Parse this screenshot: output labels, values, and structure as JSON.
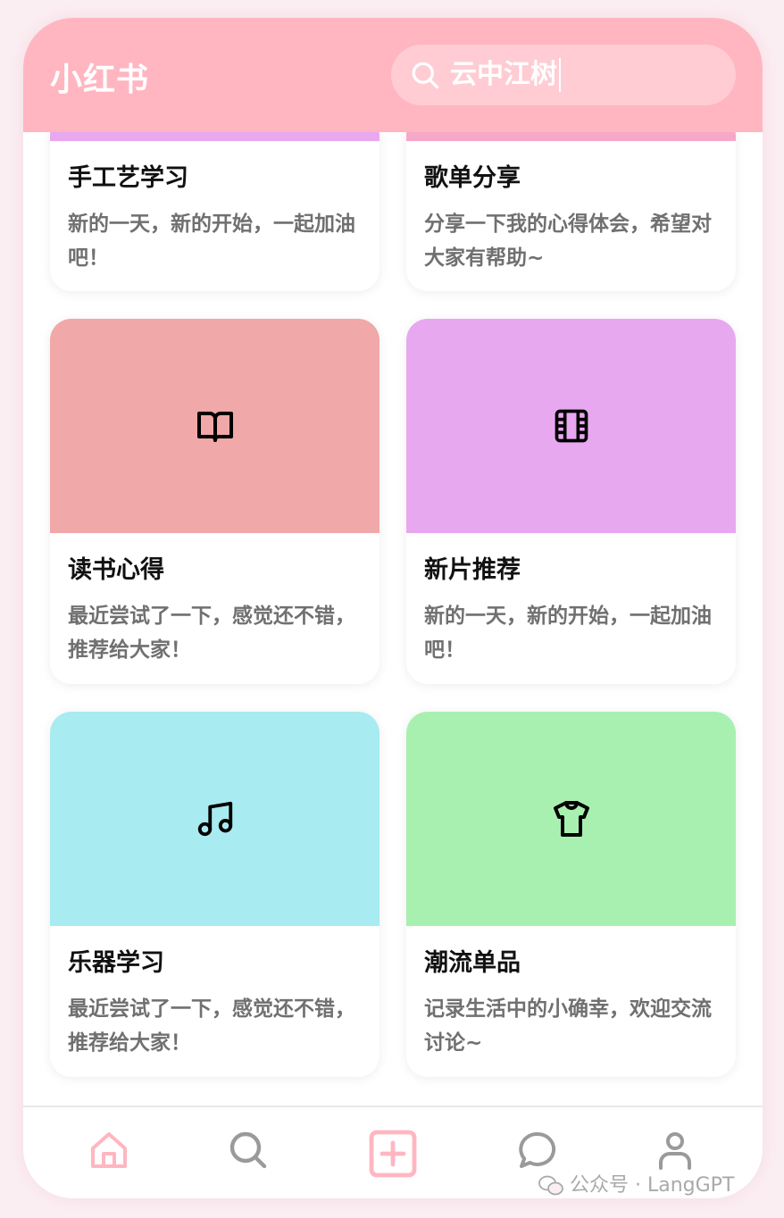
{
  "app": {
    "brand": "小红书"
  },
  "search": {
    "query": "云中江树"
  },
  "colors": {
    "header": "#ffb6c1",
    "card_top_left": "#e8a8f0",
    "card_top_right": "#f5a8c8",
    "reading": "#f0a8a8",
    "movie": "#e8a8f0",
    "music": "#a8ebf0",
    "fashion": "#a8f0b0"
  },
  "feed": {
    "cards": [
      {
        "title": "手工艺学习",
        "desc": "新的一天，新的开始，一起加油吧！",
        "icon": ""
      },
      {
        "title": "歌单分享",
        "desc": "分享一下我的心得体会，希望对大家有帮助~",
        "icon": ""
      },
      {
        "title": "读书心得",
        "desc": "最近尝试了一下，感觉还不错，推荐给大家！",
        "icon": "book-icon"
      },
      {
        "title": "新片推荐",
        "desc": "新的一天，新的开始，一起加油吧！",
        "icon": "film-icon"
      },
      {
        "title": "乐器学习",
        "desc": "最近尝试了一下，感觉还不错，推荐给大家！",
        "icon": "music-note-icon"
      },
      {
        "title": "潮流单品",
        "desc": "记录生活中的小确幸，欢迎交流讨论~",
        "icon": "tshirt-icon"
      }
    ]
  },
  "nav": {
    "items": [
      {
        "icon": "home-icon",
        "active": true
      },
      {
        "icon": "search-icon"
      },
      {
        "icon": "plus-icon"
      },
      {
        "icon": "message-icon"
      },
      {
        "icon": "profile-icon"
      }
    ]
  },
  "watermark": {
    "text": "公众号 · LangGPT"
  }
}
